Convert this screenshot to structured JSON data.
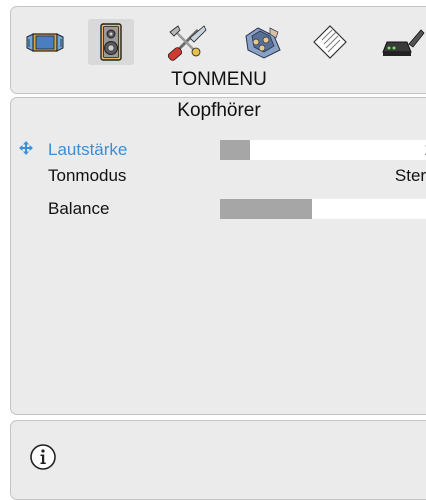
{
  "menu": {
    "title": "TONMENU",
    "icons": [
      {
        "name": "picture-icon",
        "selected": false
      },
      {
        "name": "speaker-icon",
        "selected": true
      },
      {
        "name": "tools-icon",
        "selected": false
      },
      {
        "name": "installation-icon",
        "selected": false
      },
      {
        "name": "source-icon",
        "selected": false
      },
      {
        "name": "network-icon",
        "selected": false
      }
    ]
  },
  "submenu": {
    "title": "Kopfhörer",
    "items": [
      {
        "label": "Lautstärke",
        "type": "slider",
        "value": "10",
        "level": 0.136,
        "active": true
      },
      {
        "label": "Tonmodus",
        "type": "text",
        "value": "Stereo",
        "active": false
      },
      {
        "label": "Balance",
        "type": "slider",
        "value": "0",
        "level": 0.42,
        "active": false
      }
    ]
  },
  "footer": {
    "icon": "info-icon"
  },
  "colors": {
    "panel": "#ebebeb",
    "panel_border": "#c4c4c4",
    "active_text": "#3a8fd6",
    "bar_fill": "#a6a6a6",
    "bar_track": "#ffffff"
  }
}
